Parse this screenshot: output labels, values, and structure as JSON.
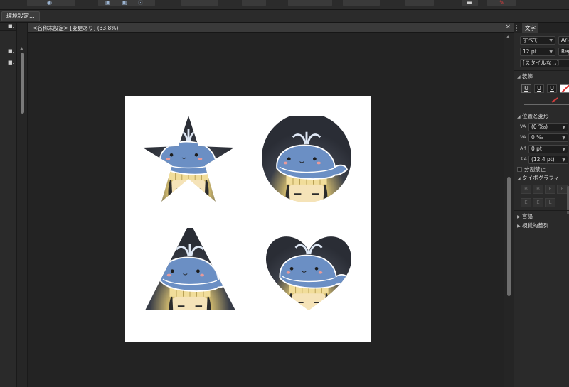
{
  "context_bar": {
    "preferences_button": "環境設定..."
  },
  "document": {
    "title": "<名称未設定> [変更あり] (33.8%)",
    "close_glyph": "×"
  },
  "left_panel": {
    "icon_glyph": "■."
  },
  "colors": {
    "background": "#1e1e1e",
    "panel": "#2a2a2a",
    "canvas_bg": "#232323",
    "artboard": "#ffffff",
    "whale_blue": "#6b8fc4",
    "no_color_slash": "#e03030"
  },
  "character_panel": {
    "tab_label": "文字",
    "font_collection": "すべて",
    "font_family": "Arial",
    "font_size": "12 pt",
    "font_style": "Regular",
    "paragraph_style": "[スタイルなし]",
    "decoration": {
      "section_label": "装飾",
      "underline_glyph": "U"
    },
    "position_transform": {
      "section_label": "位置と変形",
      "tracking": "(0 ‰)",
      "kerning": "0 ‰",
      "baseline_shift": "0 pt",
      "leading": "(12.4 pt)"
    },
    "no_break_label": "分割禁止",
    "typography_label": "タイポグラフィ",
    "language_label": "言語",
    "optical_alignment_label": "視覚的整列"
  }
}
